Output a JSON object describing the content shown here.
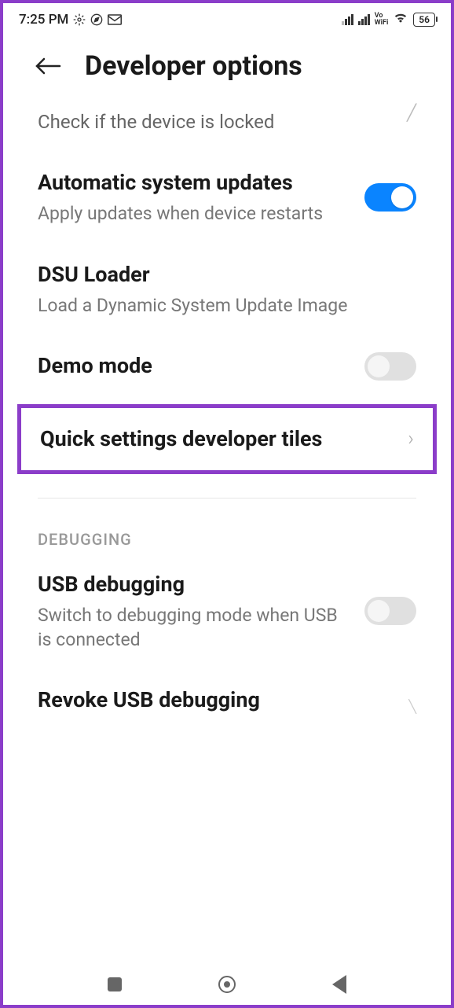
{
  "statusBar": {
    "time": "7:25 PM",
    "vowifi_top": "Vo",
    "vowifi_bottom": "WiFi",
    "battery": "56"
  },
  "header": {
    "title": "Developer options"
  },
  "items": {
    "lockCheck": {
      "desc": "Check if the device is locked"
    },
    "autoUpdates": {
      "title": "Automatic system updates",
      "desc": "Apply updates when device restarts"
    },
    "dsuLoader": {
      "title": "DSU Loader",
      "desc": "Load a Dynamic System Update Image"
    },
    "demoMode": {
      "title": "Demo mode"
    },
    "quickTiles": {
      "title": "Quick settings developer tiles"
    },
    "usbDebug": {
      "title": "USB debugging",
      "desc": "Switch to debugging mode when USB is connected"
    },
    "revokeUsb": {
      "title": "Revoke USB debugging"
    }
  },
  "sections": {
    "debugging": "DEBUGGING"
  }
}
